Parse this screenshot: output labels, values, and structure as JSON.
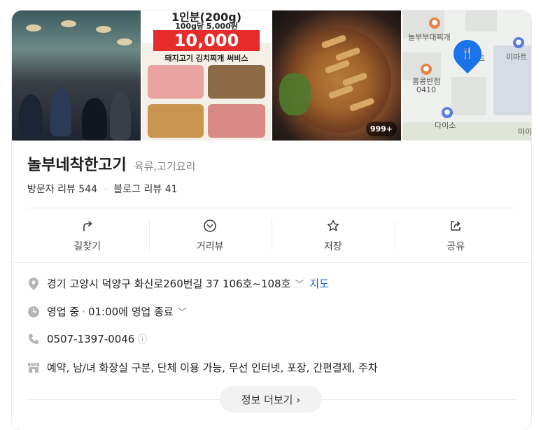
{
  "gallery": {
    "flyer": {
      "line1": "1인분(200g)",
      "line2": "100g당 5,000원",
      "price": "10,000",
      "line3": "돼지고기 김치찌개 써비스"
    },
    "photo_count": "999+",
    "map": {
      "labels": [
        "놀부부대찌개",
        "이마트",
        "홍콩반점",
        "0410",
        "다이소",
        "트",
        "마이"
      ]
    }
  },
  "place": {
    "name": "놀부네착한고기",
    "category": "육류,고기요리",
    "visitor_reviews": "방문자 리뷰 544",
    "blog_reviews": "블로그 리뷰 41",
    "separator": "·"
  },
  "actions": [
    {
      "label": "길찾기",
      "icon": "directions-icon"
    },
    {
      "label": "거리뷰",
      "icon": "street-view-icon"
    },
    {
      "label": "저장",
      "icon": "star-icon"
    },
    {
      "label": "공유",
      "icon": "share-icon"
    }
  ],
  "info": {
    "address": "경기 고양시 덕양구 화신로260번길 37 106호~108호",
    "map_link": "지도",
    "status": "영업 중",
    "hours": "01:00에 영업 종료",
    "phone": "0507-1397-0046",
    "amenities": "예약, 남/녀 화장실 구분, 단체 이용 가능, 무선 인터넷, 포장, 간편결제, 주차"
  },
  "more_button": "정보 더보기 ›",
  "colors": {
    "accent": "#1a60d8",
    "status_dot": "#e0602c",
    "price_red": "#e52b2b",
    "pin": "#1a73e8"
  }
}
